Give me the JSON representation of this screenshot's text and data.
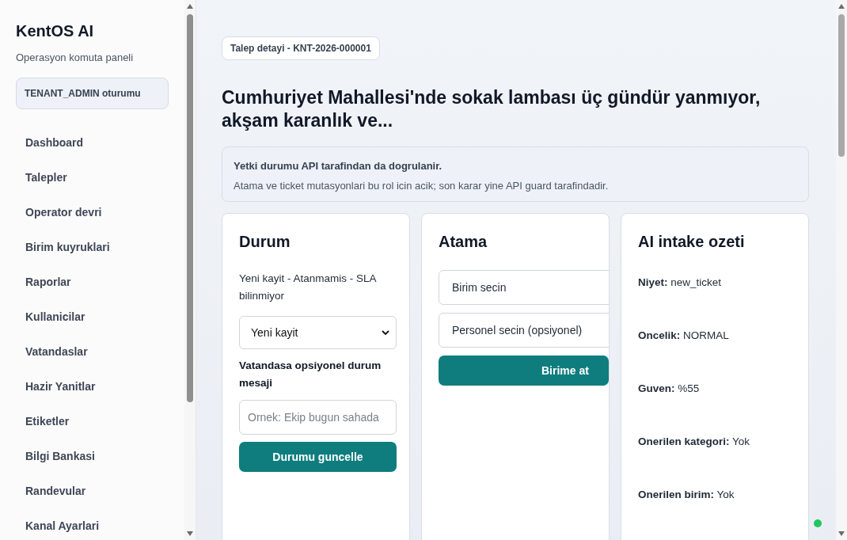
{
  "sidebar": {
    "brand": "KentOS AI",
    "subtitle": "Operasyon komuta paneli",
    "session_badge": "TENANT_ADMIN oturumu",
    "items": [
      {
        "label": "Dashboard"
      },
      {
        "label": "Talepler"
      },
      {
        "label": "Operator devri"
      },
      {
        "label": "Birim kuyruklari"
      },
      {
        "label": "Raporlar"
      },
      {
        "label": "Kullanicilar"
      },
      {
        "label": "Vatandaslar"
      },
      {
        "label": "Hazir Yanitlar"
      },
      {
        "label": "Etiketler"
      },
      {
        "label": "Bilgi Bankasi"
      },
      {
        "label": "Randevular"
      },
      {
        "label": "Kanal Ayarlari"
      }
    ]
  },
  "main": {
    "breadcrumb": "Talep detayi - KNT-2026-000001",
    "title": "Cumhuriyet Mahallesi'nde sokak lambası üç gündür yanmıyor, akşam karanlık ve...",
    "notice": {
      "title": "Yetki durumu API tarafindan da dogrulanir.",
      "text": "Atama ve ticket mutasyonlari bu rol icin acik; son karar yine API guard tarafindadir."
    },
    "status_card": {
      "heading": "Durum",
      "summary": "Yeni kayit - Atanmamis - SLA bilinmiyor",
      "status_select": "Yeni kayit",
      "message_label": "Vatandasa opsiyonel durum mesaji",
      "message_placeholder": "Ornek: Ekip bugun sahada",
      "button": "Durumu guncelle"
    },
    "assignment_card": {
      "heading": "Atama",
      "unit_select": "Birim secin",
      "staff_select": "Personel secin (opsiyonel)",
      "button": "Birime at"
    },
    "ai_card": {
      "heading": "AI intake ozeti",
      "rows": [
        {
          "text": "**Niyet:** new_ticket"
        },
        {
          "text": "**Oncelik:** NORMAL"
        },
        {
          "text": "**Guven:** %55"
        },
        {
          "text": "**Onerilen kategori:** Yok"
        },
        {
          "text": "**Onerilen birim:** Yok"
        }
      ]
    }
  }
}
